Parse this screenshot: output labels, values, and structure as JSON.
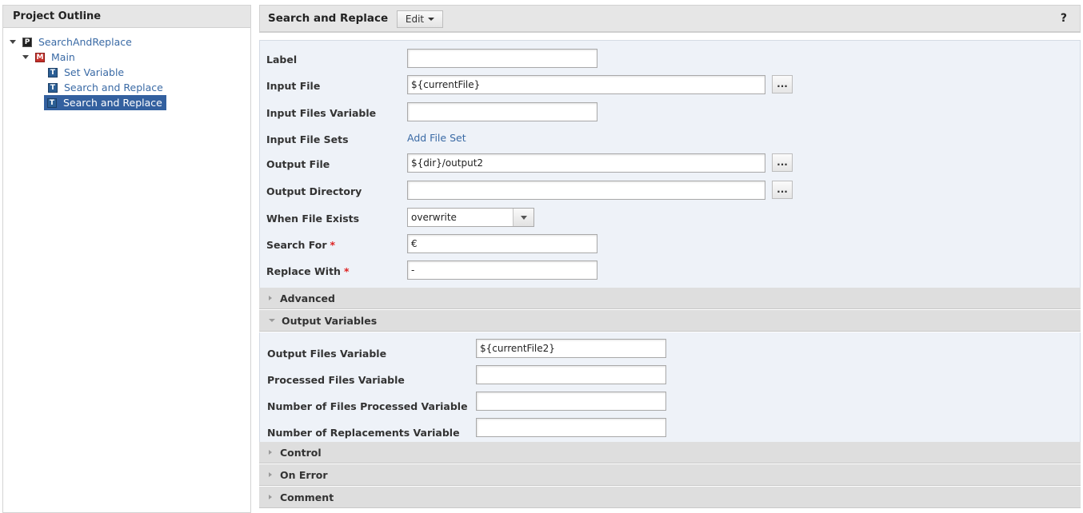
{
  "outline": {
    "title": "Project Outline",
    "project": "SearchAndReplace",
    "module": "Main",
    "tasks": [
      "Set Variable",
      "Search and Replace",
      "Search and Replace"
    ]
  },
  "icons": {
    "project": "P",
    "module": "M",
    "task": "T"
  },
  "header": {
    "title": "Search and Replace",
    "edit_label": "Edit",
    "help": "?"
  },
  "form": {
    "label": {
      "label": "Label",
      "value": ""
    },
    "input_file": {
      "label": "Input File",
      "value": "${currentFile}"
    },
    "input_files_variable": {
      "label": "Input Files Variable",
      "value": ""
    },
    "input_file_sets": {
      "label": "Input File Sets",
      "link": "Add File Set"
    },
    "output_file": {
      "label": "Output File",
      "value": "${dir}/output2"
    },
    "output_directory": {
      "label": "Output Directory",
      "value": ""
    },
    "when_file_exists": {
      "label": "When File Exists",
      "value": "overwrite"
    },
    "search_for": {
      "label": "Search For",
      "value": "€",
      "required": "*"
    },
    "replace_with": {
      "label": "Replace With",
      "value": "-",
      "required": "*"
    },
    "browse": "..."
  },
  "sections": {
    "advanced": "Advanced",
    "output_variables": "Output Variables",
    "control": "Control",
    "on_error": "On Error",
    "comment": "Comment"
  },
  "output_vars": {
    "output_files": {
      "label": "Output Files Variable",
      "value": "${currentFile2}"
    },
    "processed_files": {
      "label": "Processed Files Variable",
      "value": ""
    },
    "num_files_processed": {
      "label": "Number of Files Processed Variable",
      "value": ""
    },
    "num_replacements": {
      "label": "Number of Replacements Variable",
      "value": ""
    }
  }
}
